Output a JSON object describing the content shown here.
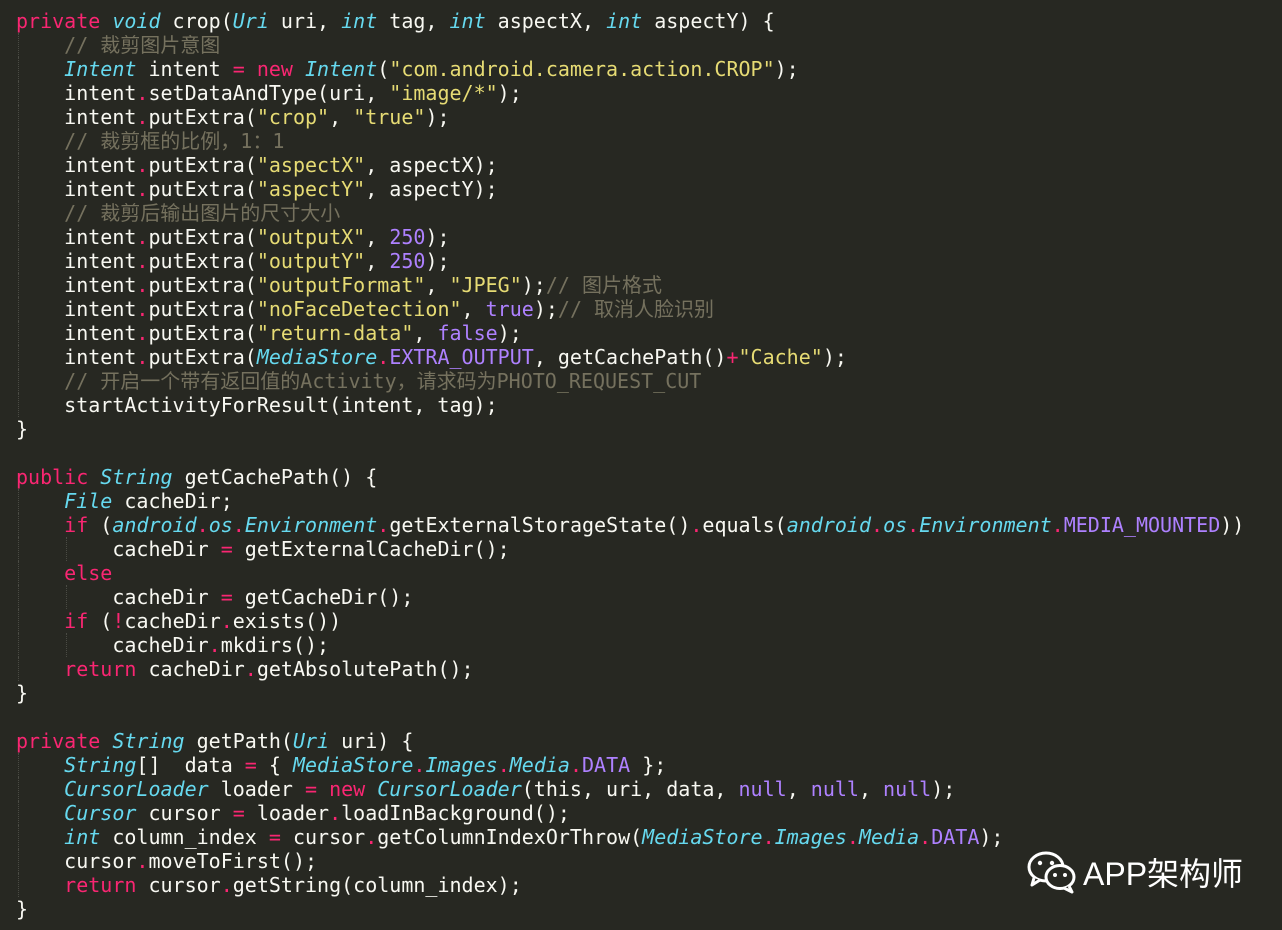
{
  "watermark": {
    "text": "APP架构师",
    "icon": "wechat-icon"
  },
  "colors": {
    "background": "#272822",
    "keyword": "#f92672",
    "type": "#66d9ef",
    "string": "#e6db74",
    "number": "#ae81ff",
    "comment": "#75715e",
    "plain": "#f8f8f2"
  },
  "code": {
    "lines": [
      [
        [
          "kw",
          "private"
        ],
        [
          "p",
          " "
        ],
        [
          "ty",
          "void"
        ],
        [
          "p",
          " crop("
        ],
        [
          "ty",
          "Uri"
        ],
        [
          "p",
          " uri, "
        ],
        [
          "ty",
          "int"
        ],
        [
          "p",
          " tag, "
        ],
        [
          "ty",
          "int"
        ],
        [
          "p",
          " aspectX, "
        ],
        [
          "ty",
          "int"
        ],
        [
          "p",
          " aspectY) {"
        ]
      ],
      [
        [
          "p",
          "    "
        ],
        [
          "cm",
          "// 裁剪图片意图"
        ]
      ],
      [
        [
          "p",
          "    "
        ],
        [
          "ty",
          "Intent"
        ],
        [
          "p",
          " intent "
        ],
        [
          "op",
          "="
        ],
        [
          "p",
          " "
        ],
        [
          "kw",
          "new"
        ],
        [
          "p",
          " "
        ],
        [
          "ty",
          "Intent"
        ],
        [
          "p",
          "("
        ],
        [
          "str",
          "\"com.android.camera.action.CROP\""
        ],
        [
          "p",
          ");"
        ]
      ],
      [
        [
          "p",
          "    intent"
        ],
        [
          "op",
          "."
        ],
        [
          "p",
          "setDataAndType(uri, "
        ],
        [
          "str",
          "\"image/*\""
        ],
        [
          "p",
          ");"
        ]
      ],
      [
        [
          "p",
          "    intent"
        ],
        [
          "op",
          "."
        ],
        [
          "p",
          "putExtra("
        ],
        [
          "str",
          "\"crop\""
        ],
        [
          "p",
          ", "
        ],
        [
          "str",
          "\"true\""
        ],
        [
          "p",
          ");"
        ]
      ],
      [
        [
          "p",
          "    "
        ],
        [
          "cm",
          "// 裁剪框的比例，1：1"
        ]
      ],
      [
        [
          "p",
          "    intent"
        ],
        [
          "op",
          "."
        ],
        [
          "p",
          "putExtra("
        ],
        [
          "str",
          "\"aspectX\""
        ],
        [
          "p",
          ", aspectX);"
        ]
      ],
      [
        [
          "p",
          "    intent"
        ],
        [
          "op",
          "."
        ],
        [
          "p",
          "putExtra("
        ],
        [
          "str",
          "\"aspectY\""
        ],
        [
          "p",
          ", aspectY);"
        ]
      ],
      [
        [
          "p",
          "    "
        ],
        [
          "cm",
          "// 裁剪后输出图片的尺寸大小"
        ]
      ],
      [
        [
          "p",
          "    intent"
        ],
        [
          "op",
          "."
        ],
        [
          "p",
          "putExtra("
        ],
        [
          "str",
          "\"outputX\""
        ],
        [
          "p",
          ", "
        ],
        [
          "num",
          "250"
        ],
        [
          "p",
          ");"
        ]
      ],
      [
        [
          "p",
          "    intent"
        ],
        [
          "op",
          "."
        ],
        [
          "p",
          "putExtra("
        ],
        [
          "str",
          "\"outputY\""
        ],
        [
          "p",
          ", "
        ],
        [
          "num",
          "250"
        ],
        [
          "p",
          ");"
        ]
      ],
      [
        [
          "p",
          "    intent"
        ],
        [
          "op",
          "."
        ],
        [
          "p",
          "putExtra("
        ],
        [
          "str",
          "\"outputFormat\""
        ],
        [
          "p",
          ", "
        ],
        [
          "str",
          "\"JPEG\""
        ],
        [
          "p",
          ");"
        ],
        [
          "cm",
          "// 图片格式"
        ]
      ],
      [
        [
          "p",
          "    intent"
        ],
        [
          "op",
          "."
        ],
        [
          "p",
          "putExtra("
        ],
        [
          "str",
          "\"noFaceDetection\""
        ],
        [
          "p",
          ", "
        ],
        [
          "const",
          "true"
        ],
        [
          "p",
          ");"
        ],
        [
          "cm",
          "// 取消人脸识别"
        ]
      ],
      [
        [
          "p",
          "    intent"
        ],
        [
          "op",
          "."
        ],
        [
          "p",
          "putExtra("
        ],
        [
          "str",
          "\"return-data\""
        ],
        [
          "p",
          ", "
        ],
        [
          "const",
          "false"
        ],
        [
          "p",
          ");"
        ]
      ],
      [
        [
          "p",
          "    intent"
        ],
        [
          "op",
          "."
        ],
        [
          "p",
          "putExtra("
        ],
        [
          "ty",
          "MediaStore"
        ],
        [
          "op",
          "."
        ],
        [
          "const",
          "EXTRA_OUTPUT"
        ],
        [
          "p",
          ", getCachePath()"
        ],
        [
          "op",
          "+"
        ],
        [
          "str",
          "\"Cache\""
        ],
        [
          "p",
          ");"
        ]
      ],
      [
        [
          "p",
          "    "
        ],
        [
          "cm",
          "// 开启一个带有返回值的Activity，请求码为PHOTO_REQUEST_CUT"
        ]
      ],
      [
        [
          "p",
          "    startActivityForResult(intent, tag);"
        ]
      ],
      [
        [
          "p",
          "}"
        ]
      ],
      [
        [
          "p",
          ""
        ]
      ],
      [
        [
          "kw",
          "public"
        ],
        [
          "p",
          " "
        ],
        [
          "ty",
          "String"
        ],
        [
          "p",
          " getCachePath() {"
        ]
      ],
      [
        [
          "p",
          "    "
        ],
        [
          "ty",
          "File"
        ],
        [
          "p",
          " cacheDir;"
        ]
      ],
      [
        [
          "p",
          "    "
        ],
        [
          "kw",
          "if"
        ],
        [
          "p",
          " ("
        ],
        [
          "ty",
          "android"
        ],
        [
          "op",
          "."
        ],
        [
          "ty",
          "os"
        ],
        [
          "op",
          "."
        ],
        [
          "ty",
          "Environment"
        ],
        [
          "op",
          "."
        ],
        [
          "p",
          "getExternalStorageState()"
        ],
        [
          "op",
          "."
        ],
        [
          "p",
          "equals("
        ],
        [
          "ty",
          "android"
        ],
        [
          "op",
          "."
        ],
        [
          "ty",
          "os"
        ],
        [
          "op",
          "."
        ],
        [
          "ty",
          "Environment"
        ],
        [
          "op",
          "."
        ],
        [
          "const",
          "MEDIA_MOUNTED"
        ],
        [
          "p",
          "))"
        ]
      ],
      [
        [
          "p",
          "        cacheDir "
        ],
        [
          "op",
          "="
        ],
        [
          "p",
          " getExternalCacheDir();"
        ]
      ],
      [
        [
          "p",
          "    "
        ],
        [
          "kw",
          "else"
        ]
      ],
      [
        [
          "p",
          "        cacheDir "
        ],
        [
          "op",
          "="
        ],
        [
          "p",
          " getCacheDir();"
        ]
      ],
      [
        [
          "p",
          "    "
        ],
        [
          "kw",
          "if"
        ],
        [
          "p",
          " ("
        ],
        [
          "op",
          "!"
        ],
        [
          "p",
          "cacheDir"
        ],
        [
          "op",
          "."
        ],
        [
          "p",
          "exists())"
        ]
      ],
      [
        [
          "p",
          "        cacheDir"
        ],
        [
          "op",
          "."
        ],
        [
          "p",
          "mkdirs();"
        ]
      ],
      [
        [
          "p",
          "    "
        ],
        [
          "kw",
          "return"
        ],
        [
          "p",
          " cacheDir"
        ],
        [
          "op",
          "."
        ],
        [
          "p",
          "getAbsolutePath();"
        ]
      ],
      [
        [
          "p",
          "}"
        ]
      ],
      [
        [
          "p",
          ""
        ]
      ],
      [
        [
          "kw",
          "private"
        ],
        [
          "p",
          " "
        ],
        [
          "ty",
          "String"
        ],
        [
          "p",
          " getPath("
        ],
        [
          "ty",
          "Uri"
        ],
        [
          "p",
          " uri) {"
        ]
      ],
      [
        [
          "p",
          "    "
        ],
        [
          "ty",
          "String"
        ],
        [
          "p",
          "[]  data "
        ],
        [
          "op",
          "="
        ],
        [
          "p",
          " { "
        ],
        [
          "ty",
          "MediaStore"
        ],
        [
          "op",
          "."
        ],
        [
          "ty",
          "Images"
        ],
        [
          "op",
          "."
        ],
        [
          "ty",
          "Media"
        ],
        [
          "op",
          "."
        ],
        [
          "const",
          "DATA"
        ],
        [
          "p",
          " };"
        ]
      ],
      [
        [
          "p",
          "    "
        ],
        [
          "ty",
          "CursorLoader"
        ],
        [
          "p",
          " loader "
        ],
        [
          "op",
          "="
        ],
        [
          "p",
          " "
        ],
        [
          "kw",
          "new"
        ],
        [
          "p",
          " "
        ],
        [
          "ty",
          "CursorLoader"
        ],
        [
          "p",
          "(this, uri, data, "
        ],
        [
          "const",
          "null"
        ],
        [
          "p",
          ", "
        ],
        [
          "const",
          "null"
        ],
        [
          "p",
          ", "
        ],
        [
          "const",
          "null"
        ],
        [
          "p",
          ");"
        ]
      ],
      [
        [
          "p",
          "    "
        ],
        [
          "ty",
          "Cursor"
        ],
        [
          "p",
          " cursor "
        ],
        [
          "op",
          "="
        ],
        [
          "p",
          " loader"
        ],
        [
          "op",
          "."
        ],
        [
          "p",
          "loadInBackground();"
        ]
      ],
      [
        [
          "p",
          "    "
        ],
        [
          "ty",
          "int"
        ],
        [
          "p",
          " column_index "
        ],
        [
          "op",
          "="
        ],
        [
          "p",
          " cursor"
        ],
        [
          "op",
          "."
        ],
        [
          "p",
          "getColumnIndexOrThrow("
        ],
        [
          "ty",
          "MediaStore"
        ],
        [
          "op",
          "."
        ],
        [
          "ty",
          "Images"
        ],
        [
          "op",
          "."
        ],
        [
          "ty",
          "Media"
        ],
        [
          "op",
          "."
        ],
        [
          "const",
          "DATA"
        ],
        [
          "p",
          ");"
        ]
      ],
      [
        [
          "p",
          "    cursor"
        ],
        [
          "op",
          "."
        ],
        [
          "p",
          "moveToFirst();"
        ]
      ],
      [
        [
          "p",
          "    "
        ],
        [
          "kw",
          "return"
        ],
        [
          "p",
          " cursor"
        ],
        [
          "op",
          "."
        ],
        [
          "p",
          "getString(column_index);"
        ]
      ],
      [
        [
          "p",
          "}"
        ]
      ]
    ]
  }
}
